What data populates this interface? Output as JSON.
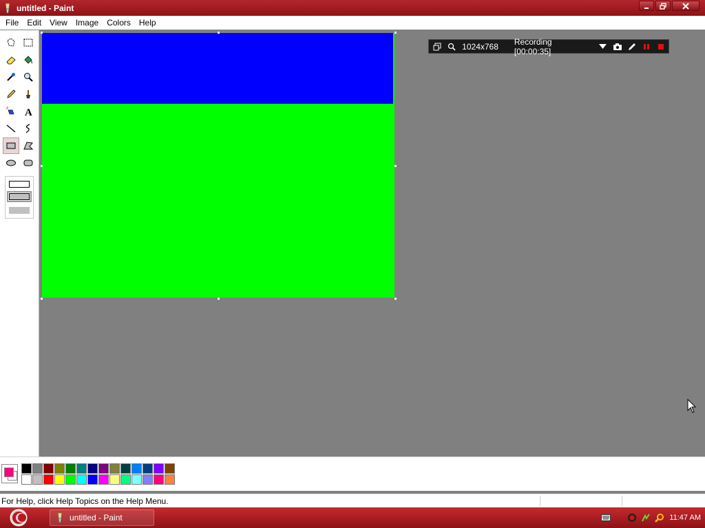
{
  "window": {
    "title": "untitled - Paint"
  },
  "menu": [
    "File",
    "Edit",
    "View",
    "Image",
    "Colors",
    "Help"
  ],
  "toolbox": {
    "tools": [
      "free-form-select-icon",
      "select-icon",
      "eraser-icon",
      "fill-bucket-icon",
      "pick-color-icon",
      "magnifier-icon",
      "pencil-icon",
      "brush-icon",
      "airbrush-icon",
      "text-icon",
      "line-icon",
      "curve-icon",
      "rectangle-icon",
      "polygon-icon",
      "ellipse-icon",
      "rounded-rectangle-icon"
    ],
    "active_tool": "rectangle-icon"
  },
  "canvas": {
    "top_color": "#0000ff",
    "bottom_color": "#00ff00"
  },
  "recorder": {
    "resolution": "1024x768",
    "status": "Recording [00:00:35]"
  },
  "palette": {
    "foreground": "#ff0080",
    "background": "#ffffff",
    "colors": [
      "#000000",
      "#808080",
      "#800000",
      "#808000",
      "#008000",
      "#008080",
      "#000080",
      "#800080",
      "#808040",
      "#004040",
      "#0080ff",
      "#004080",
      "#8000ff",
      "#804000",
      "#ffffff",
      "#c0c0c0",
      "#ff0000",
      "#ffff00",
      "#00ff00",
      "#00ffff",
      "#0000ff",
      "#ff00ff",
      "#ffff80",
      "#00ff80",
      "#80ffff",
      "#8080ff",
      "#ff0080",
      "#ff8040"
    ]
  },
  "status": {
    "help_text": "For Help, click Help Topics on the Help Menu."
  },
  "taskbar": {
    "task_label": "untitled - Paint",
    "clock": "11:47 AM"
  }
}
